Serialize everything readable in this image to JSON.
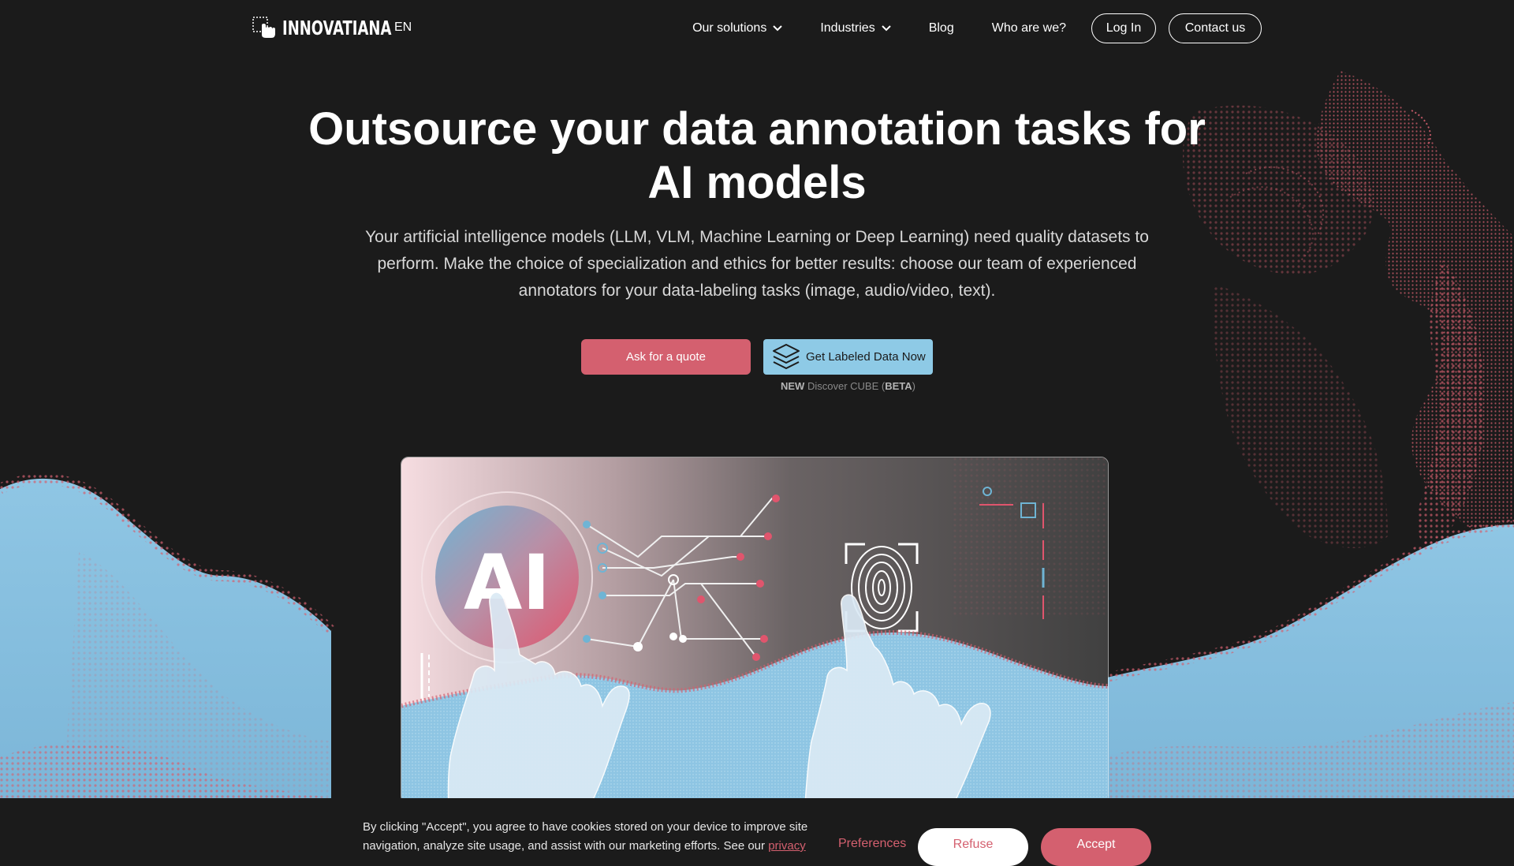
{
  "nav": {
    "logo_text": "INNOVATIANA",
    "language": "EN",
    "links": {
      "solutions": "Our solutions",
      "industries": "Industries",
      "blog": "Blog",
      "who": "Who are we?"
    },
    "login": "Log In",
    "contact": "Contact us"
  },
  "hero": {
    "title": "Outsource your data annotation tasks for AI models",
    "subtitle": "Your artificial intelligence models (LLM, VLM, Machine Learning or Deep Learning) need quality datasets to perform. Make the choice of specialization and ethics for better results: choose our team of experienced annotators for your data-labeling tasks (image, audio/video, text).",
    "quote_button": "Ask for a quote",
    "cube_button": "Get Labeled Data Now",
    "cube_note": {
      "new": "NEW",
      "text": "Discover CUBE (",
      "beta": "BETA",
      "close": ")"
    },
    "image_ai_text": "AI"
  },
  "cookie": {
    "text": "By clicking \"Accept\", you agree to have cookies stored on your device to improve site navigation, analyze site usage, and assist with our marketing efforts. See our",
    "privacy_link": "privacy",
    "preferences": "Preferences",
    "refuse": "Refuse",
    "accept": "Accept"
  },
  "colors": {
    "background": "#1b1b1b",
    "accent_pink": "#d4606f",
    "accent_blue": "#8ecae6",
    "text": "#ffffff"
  },
  "icons": {
    "logo": "hand-cursor-selection-icon",
    "chevron": "chevron-down-icon",
    "cube_button": "layers-stack-icon",
    "fingerprint": "fingerprint-icon"
  }
}
